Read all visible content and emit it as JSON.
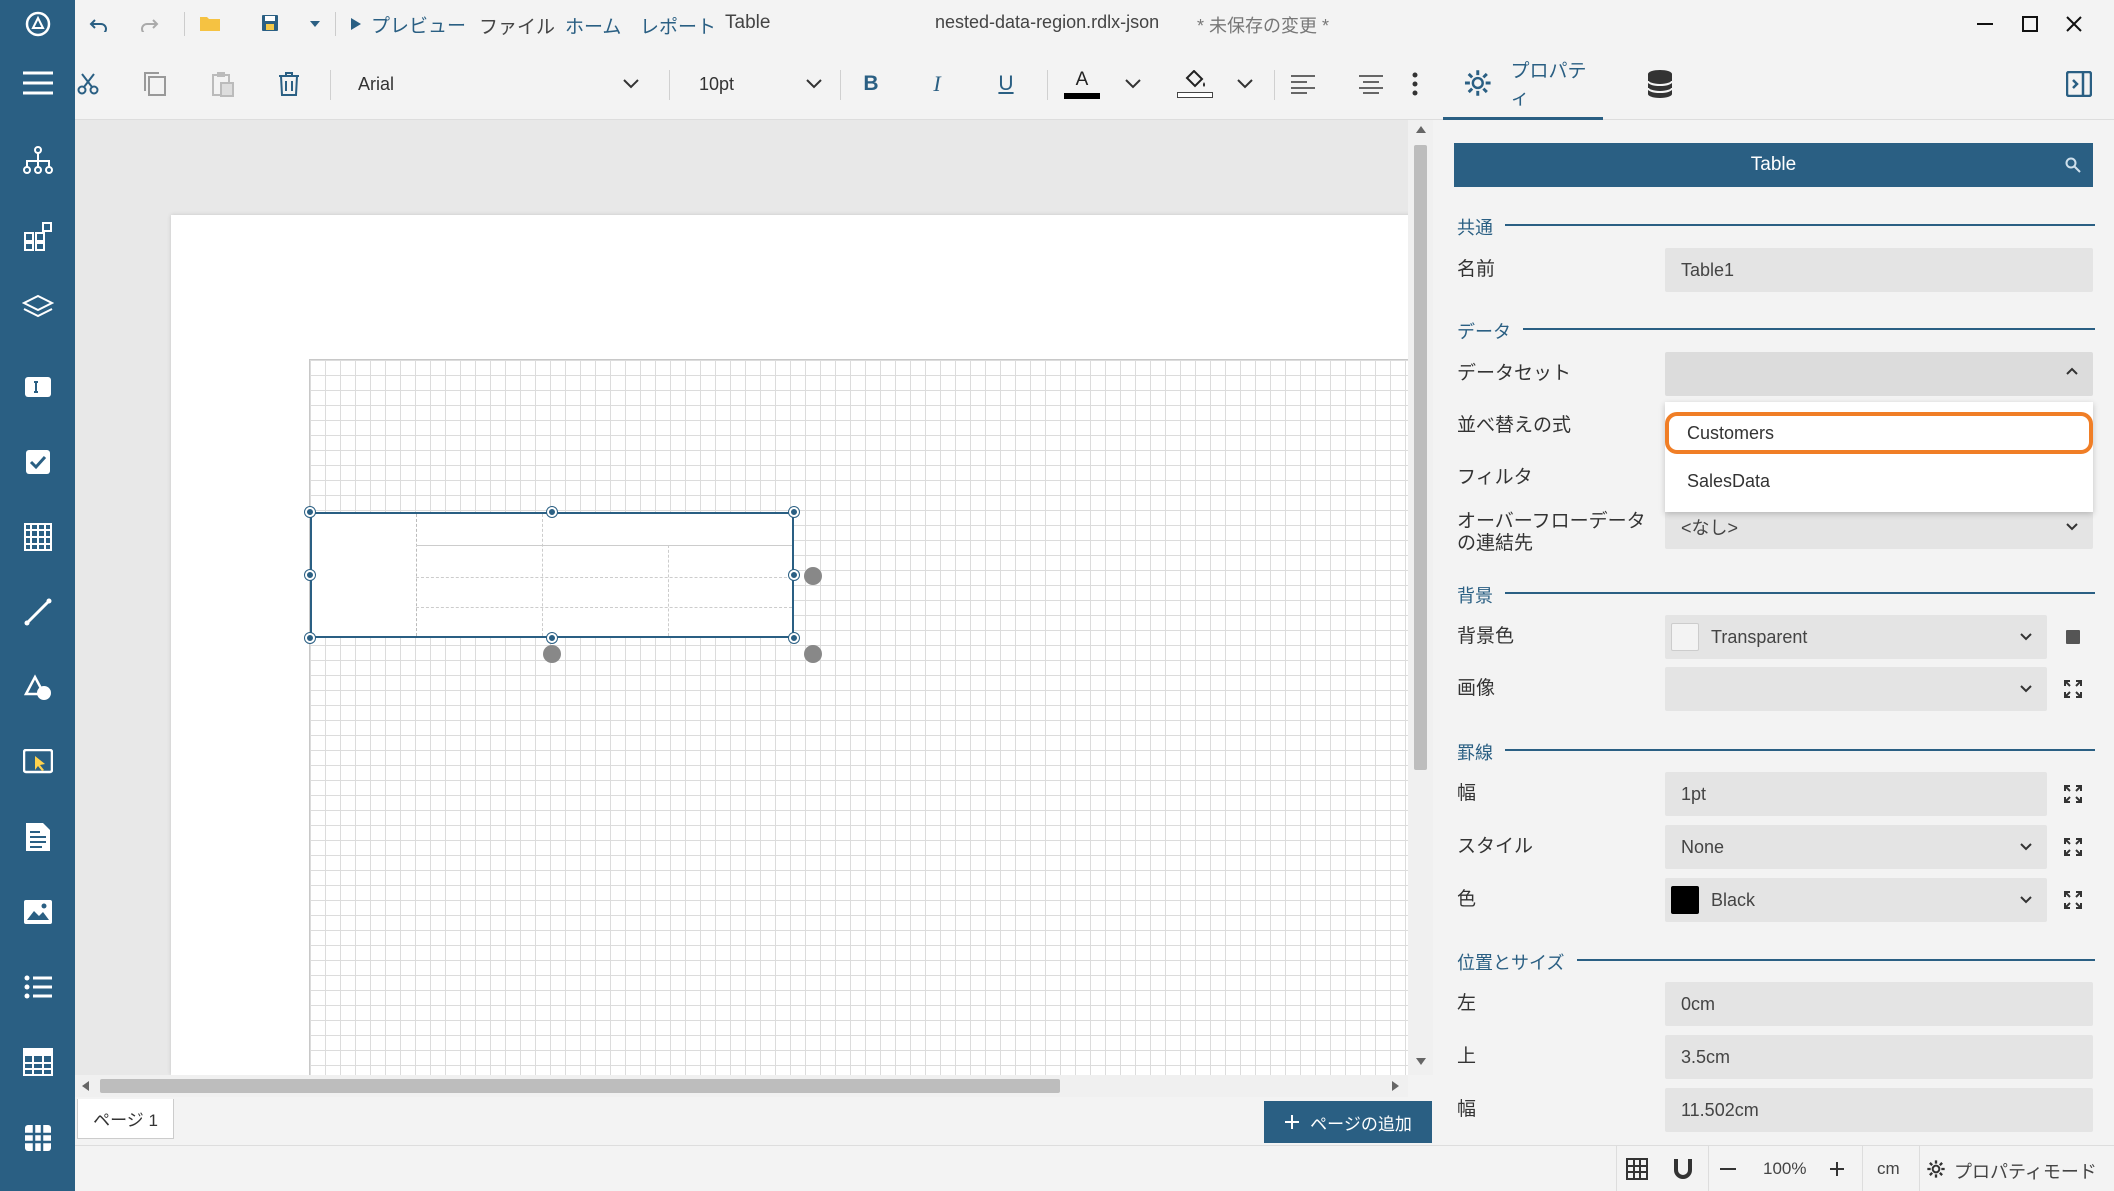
{
  "titlebar": {
    "preview": "プレビュー",
    "menu": [
      "ファイル",
      "ホーム",
      "レポート",
      "Table"
    ],
    "filename": "nested-data-region.rdlx-json",
    "unsaved": "* 未保存の変更 *"
  },
  "toolbar": {
    "font_family": "Arial",
    "font_size": "10pt",
    "bold": "B",
    "italic": "I",
    "underline": "U",
    "font_color_glyph": "A",
    "properties_tab": "プロパティ"
  },
  "properties": {
    "header_title": "Table",
    "common": {
      "heading": "共通",
      "name_label": "名前",
      "name_value": "Table1"
    },
    "data": {
      "heading": "データ",
      "dataset_label": "データセット",
      "dataset_value": "",
      "dataset_options": [
        "Customers",
        "SalesData"
      ],
      "sort_label": "並べ替えの式",
      "filter_label": "フィルタ",
      "overflow_label_line1": "オーバーフローデータ",
      "overflow_label_line2": "の連結先",
      "overflow_value": "<なし>"
    },
    "background": {
      "heading": "背景",
      "color_label": "背景色",
      "color_value": "Transparent",
      "image_label": "画像",
      "image_value": ""
    },
    "border": {
      "heading": "罫線",
      "width_label": "幅",
      "width_value": "1pt",
      "style_label": "スタイル",
      "style_value": "None",
      "color_label": "色",
      "color_value": "Black"
    },
    "position": {
      "heading": "位置とサイズ",
      "left_label": "左",
      "left_value": "0cm",
      "top_label": "上",
      "top_value": "3.5cm",
      "width_label": "幅",
      "width_value": "11.502cm"
    }
  },
  "pagebar": {
    "page_tab": "ページ 1",
    "add_page": "ページの追加"
  },
  "statusbar": {
    "zoom": "100%",
    "unit": "cm",
    "mode": "プロパティモード"
  },
  "colors": {
    "sidebar": "#2a5f83",
    "accent": "#2a5f83",
    "highlight": "#f07e26"
  }
}
